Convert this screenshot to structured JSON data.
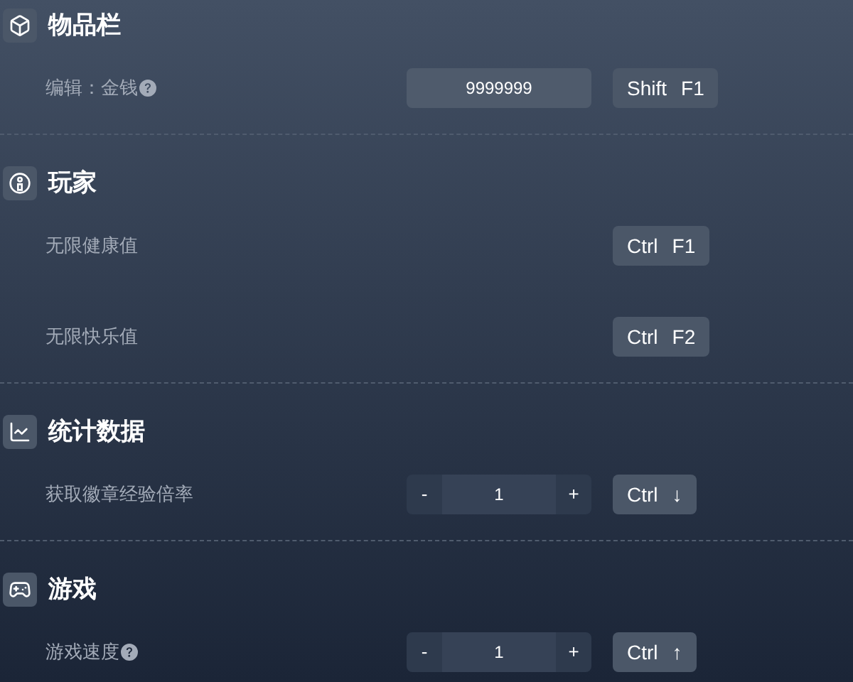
{
  "sections": [
    {
      "title": "物品栏",
      "rows": [
        {
          "label": "编辑：金钱",
          "help": true,
          "control": {
            "kind": "number_input",
            "value": "9999999"
          },
          "hotkey": [
            "Shift",
            "F1"
          ]
        }
      ]
    },
    {
      "title": "玩家",
      "rows": [
        {
          "label": "无限健康值",
          "help": false,
          "hotkey": [
            "Ctrl",
            "F1"
          ]
        },
        {
          "label": "无限快乐值",
          "help": false,
          "hotkey": [
            "Ctrl",
            "F2"
          ]
        }
      ]
    },
    {
      "title": "统计数据",
      "rows": [
        {
          "label": "获取徽章经验倍率",
          "help": false,
          "control": {
            "kind": "stepper",
            "minus": "-",
            "value": "1",
            "plus": "+"
          },
          "hotkey": [
            "Ctrl",
            "↓"
          ]
        }
      ]
    },
    {
      "title": "游戏",
      "rows": [
        {
          "label": "游戏速度",
          "help": true,
          "control": {
            "kind": "stepper",
            "minus": "-",
            "value": "1",
            "plus": "+"
          },
          "hotkey": [
            "Ctrl",
            "↑"
          ]
        }
      ]
    }
  ]
}
